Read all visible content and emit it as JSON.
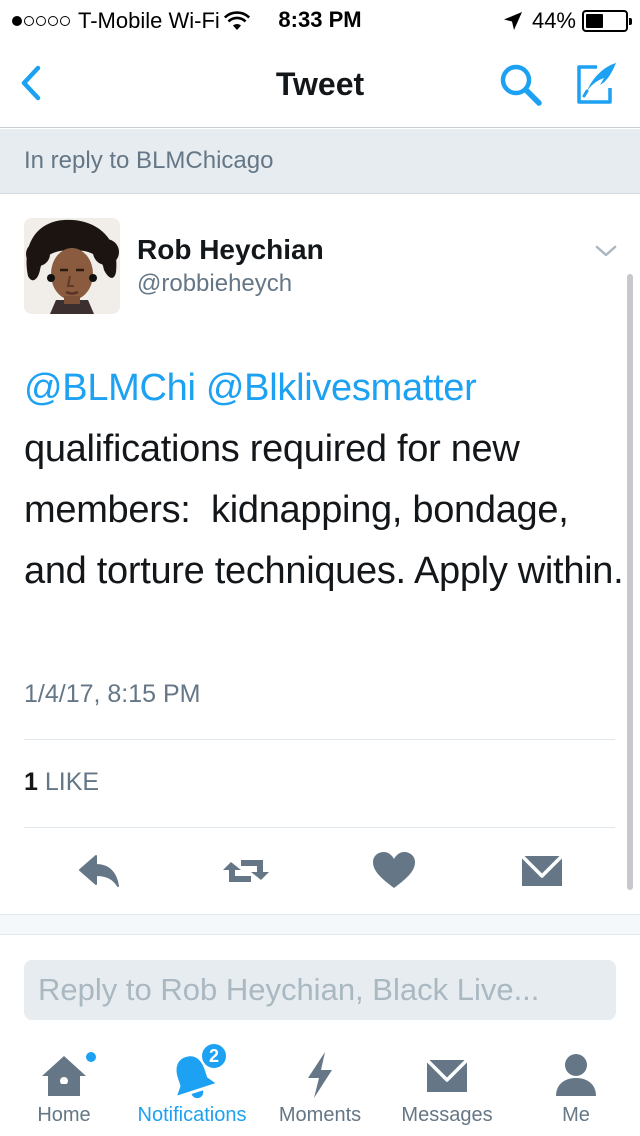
{
  "status_bar": {
    "carrier": "T-Mobile Wi-Fi",
    "time": "8:33 PM",
    "battery_text": "44%",
    "battery_level": 0.44
  },
  "nav": {
    "title": "Tweet",
    "back_icon": "chevron-left-icon",
    "search_icon": "search-icon",
    "compose_icon": "compose-icon"
  },
  "reply_context": "In reply to BLMChicago",
  "tweet": {
    "author_name": "Rob Heychian",
    "author_handle": "@robbieheych",
    "mentions": [
      "@BLMChi",
      "@Blklivesmatter"
    ],
    "text": "qualifications required for new members:  kidnapping, bondage, and torture techniques. Apply within.",
    "timestamp": "1/4/17, 8:15 PM",
    "like_count": "1",
    "like_label": "LIKE"
  },
  "reply_input": {
    "placeholder": "Reply to Rob Heychian, Black Live..."
  },
  "tabs": [
    {
      "label": "Home",
      "icon": "home-icon"
    },
    {
      "label": "Notifications",
      "icon": "bell-icon",
      "badge": "2",
      "active": true
    },
    {
      "label": "Moments",
      "icon": "lightning-icon"
    },
    {
      "label": "Messages",
      "icon": "envelope-icon"
    },
    {
      "label": "Me",
      "icon": "person-icon"
    }
  ],
  "colors": {
    "accent": "#1da1f2",
    "secondary_text": "#657786",
    "banner_bg": "#e6ecf0"
  }
}
